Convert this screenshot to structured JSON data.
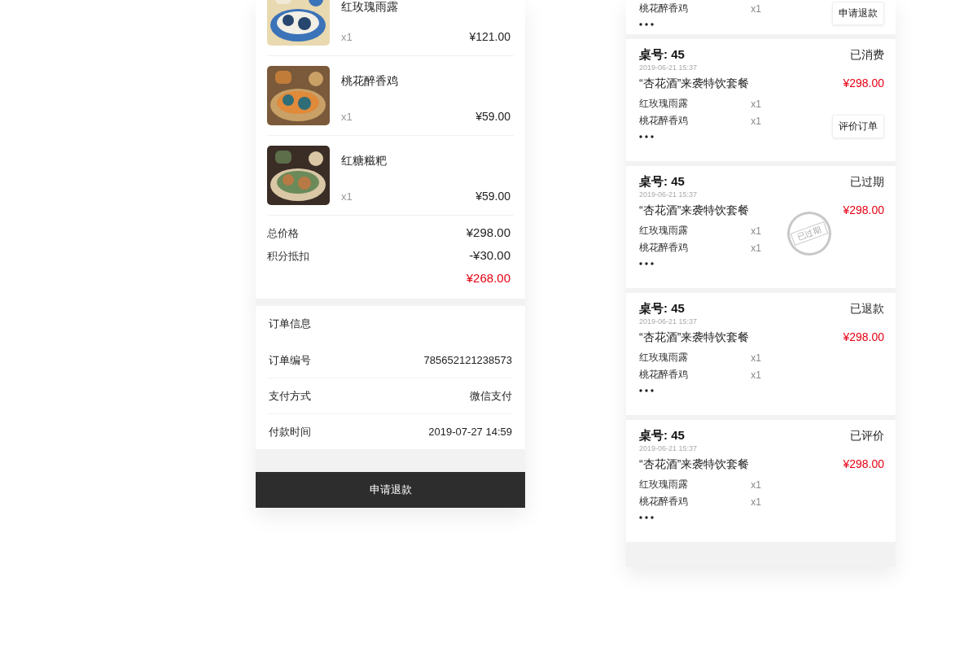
{
  "order_detail": {
    "items": [
      {
        "name": "红玫瑰雨露",
        "qty": "x1",
        "price": "¥121.00"
      },
      {
        "name": "桃花醉香鸡",
        "qty": "x1",
        "price": "¥59.00"
      },
      {
        "name": "红糖糍粑",
        "qty": "x1",
        "price": "¥59.00"
      }
    ],
    "totals": [
      {
        "label": "总价格",
        "value": "¥298.00",
        "kind": "plain"
      },
      {
        "label": "积分抵扣",
        "value": "-¥30.00",
        "kind": "plain"
      },
      {
        "value": "¥268.00",
        "kind": "final"
      }
    ],
    "info_title": "订单信息",
    "info": [
      {
        "label": "订单编号",
        "value": "785652121238573"
      },
      {
        "label": "支付方式",
        "value": "微信支付"
      },
      {
        "label": "付款时间",
        "value": "2019-07-27 14:59"
      }
    ],
    "button": "申请退款"
  },
  "order_list": [
    {
      "items": [
        {
          "name": "桃花醉香鸡",
          "qty": "x1"
        }
      ],
      "action": "申请退款"
    },
    {
      "table": "桌号: 45",
      "status": "已消费",
      "date": "2019-06-21 15:37",
      "package": "“杏花酒”来袭特饮套餐",
      "price": "¥298.00",
      "items": [
        {
          "name": "红玫瑰雨露",
          "qty": "x1"
        },
        {
          "name": "桃花醉香鸡",
          "qty": "x1"
        }
      ],
      "action": "评价订单"
    },
    {
      "table": "桌号: 45",
      "status": "已过期",
      "date": "2019-06-21 15:37",
      "package": "“杏花酒”来袭特饮套餐",
      "price": "¥298.00",
      "items": [
        {
          "name": "红玫瑰雨露",
          "qty": "x1"
        },
        {
          "name": "桃花醉香鸡",
          "qty": "x1"
        }
      ],
      "stamp": "已过期"
    },
    {
      "table": "桌号: 45",
      "status": "已退款",
      "date": "2019-06-21 15:37",
      "package": "“杏花酒”来袭特饮套餐",
      "price": "¥298.00",
      "items": [
        {
          "name": "红玫瑰雨露",
          "qty": "x1"
        },
        {
          "name": "桃花醉香鸡",
          "qty": "x1"
        }
      ]
    },
    {
      "table": "桌号: 45",
      "status": "已评价",
      "date": "2019-06-21 15:37",
      "package": "“杏花酒”来袭特饮套餐",
      "price": "¥298.00",
      "items": [
        {
          "name": "红玫瑰雨露",
          "qty": "x1"
        },
        {
          "name": "桃花醉香鸡",
          "qty": "x1"
        }
      ]
    }
  ]
}
